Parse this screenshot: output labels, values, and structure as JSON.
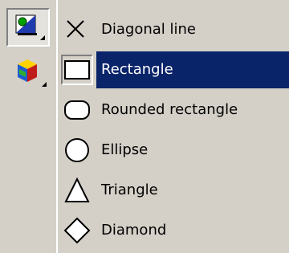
{
  "toolbar": {
    "buttons": [
      {
        "icon": "shape-tool-icon",
        "state": "pressed",
        "has_dropdown": true
      },
      {
        "icon": "3d-cube-tool-icon",
        "state": "normal",
        "has_dropdown": true
      }
    ]
  },
  "menu": {
    "items": [
      {
        "label": "Diagonal line",
        "icon": "diagonal-line-icon",
        "selected": false
      },
      {
        "label": "Rectangle",
        "icon": "rectangle-icon",
        "selected": true
      },
      {
        "label": "Rounded rectangle",
        "icon": "rounded-rectangle-icon",
        "selected": false
      },
      {
        "label": "Ellipse",
        "icon": "ellipse-icon",
        "selected": false
      },
      {
        "label": "Triangle",
        "icon": "triangle-icon",
        "selected": false
      },
      {
        "label": "Diamond",
        "icon": "diamond-icon",
        "selected": false
      }
    ]
  },
  "colors": {
    "face": "#d4d0c8",
    "highlight": "#0a246a",
    "highlight_text": "#ffffff",
    "text": "#000000"
  }
}
